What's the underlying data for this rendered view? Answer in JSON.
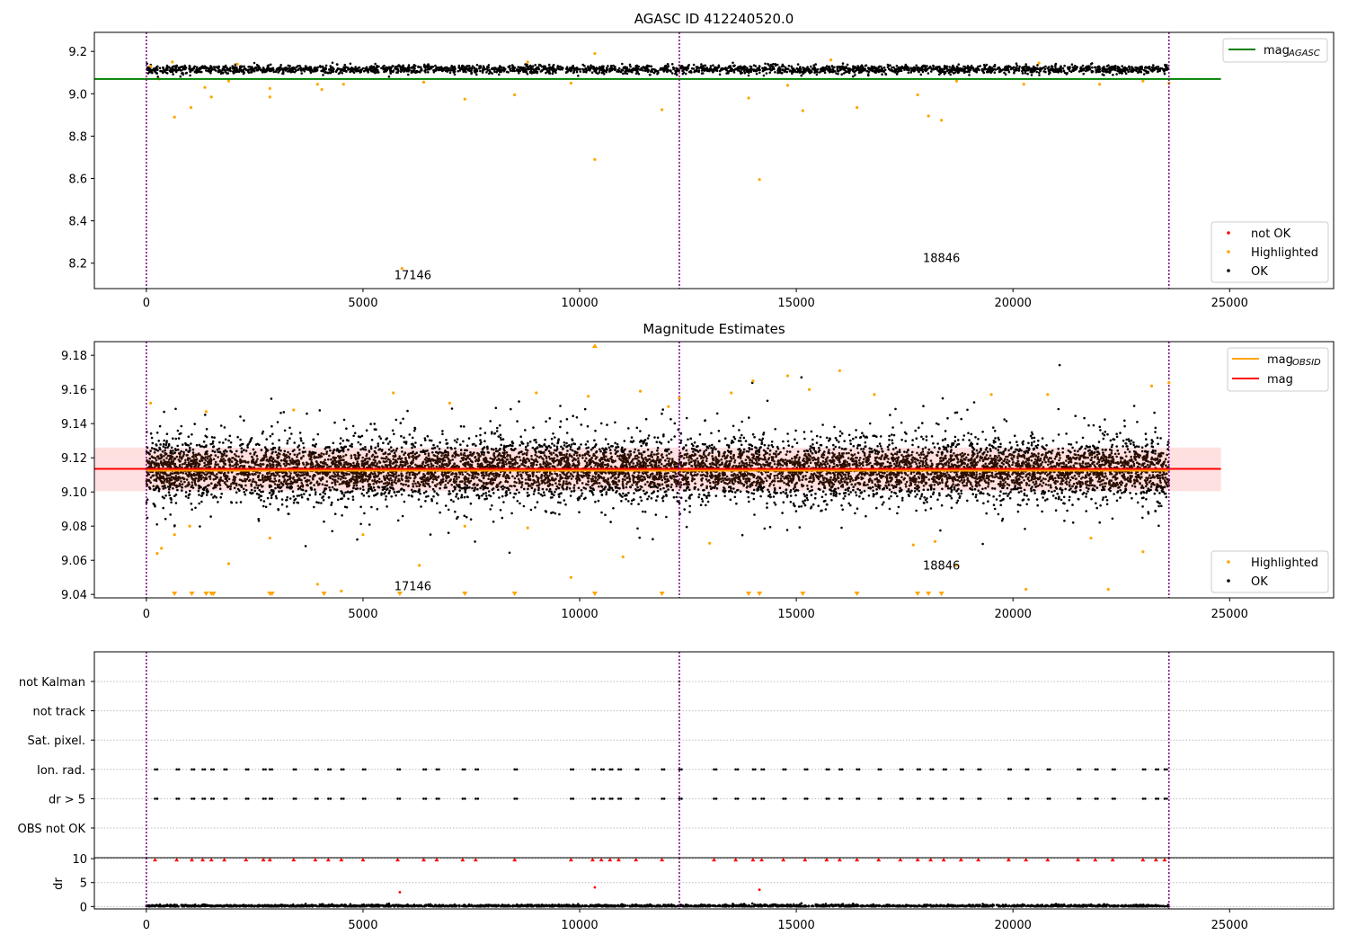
{
  "chart_data": [
    {
      "type": "scatter",
      "title": "AGASC ID 412240520.0",
      "xlim": [
        -1200,
        27400
      ],
      "ylim": [
        8.08,
        9.29
      ],
      "xticks": [
        "0",
        "5000",
        "10000",
        "15000",
        "20000",
        "25000"
      ],
      "xtick_values": [
        0,
        5000,
        10000,
        15000,
        20000,
        25000
      ],
      "yticks": [
        "8.2",
        "8.4",
        "8.6",
        "8.8",
        "9.0",
        "9.2"
      ],
      "ytick_values": [
        8.2,
        8.4,
        8.6,
        8.8,
        9.0,
        9.2
      ],
      "legend_upper": {
        "placement": "top-right",
        "entries": [
          {
            "label": "mag",
            "sub": "AGASC",
            "color": "#008000",
            "kind": "line"
          }
        ]
      },
      "legend_lower": {
        "placement": "bottom-right",
        "entries": [
          {
            "label": "not OK",
            "color": "#ff0000",
            "kind": "dot"
          },
          {
            "label": "Highlighted",
            "color": "#ffa500",
            "kind": "dot"
          },
          {
            "label": "OK",
            "color": "#000000",
            "kind": "dot"
          }
        ]
      },
      "mag_agasc": 9.07,
      "mag_agasc_xrange": [
        -1200,
        24800
      ],
      "obs_boundaries": [
        0,
        12300,
        23600
      ],
      "annotations": [
        {
          "text": "17146",
          "x": 6150,
          "y": 8.125
        },
        {
          "text": "18846",
          "x": 18350,
          "y": 8.205
        }
      ],
      "band": {
        "center": 9.115,
        "spread": 0.02
      },
      "highlighted_points": [
        [
          100,
          9.13
        ],
        [
          300,
          9.07
        ],
        [
          650,
          8.89
        ],
        [
          1030,
          8.935
        ],
        [
          1350,
          9.03
        ],
        [
          1500,
          8.985
        ],
        [
          1900,
          9.06
        ],
        [
          2850,
          9.025
        ],
        [
          2850,
          8.985
        ],
        [
          4050,
          9.02
        ],
        [
          4550,
          9.045
        ],
        [
          3950,
          9.045
        ],
        [
          5900,
          8.175
        ],
        [
          6400,
          9.055
        ],
        [
          7350,
          8.975
        ],
        [
          8500,
          8.995
        ],
        [
          9800,
          9.05
        ],
        [
          10350,
          9.19
        ],
        [
          10350,
          8.69
        ],
        [
          11900,
          8.925
        ],
        [
          13900,
          8.98
        ],
        [
          14150,
          8.595
        ],
        [
          14800,
          9.04
        ],
        [
          15150,
          8.92
        ],
        [
          16400,
          8.935
        ],
        [
          17800,
          8.995
        ],
        [
          18050,
          8.895
        ],
        [
          18350,
          8.875
        ],
        [
          18700,
          9.06
        ],
        [
          20250,
          9.045
        ],
        [
          22000,
          9.045
        ],
        [
          23000,
          9.06
        ],
        [
          23600,
          9.05
        ],
        [
          600,
          9.15
        ],
        [
          2100,
          9.14
        ],
        [
          8800,
          9.15
        ],
        [
          15800,
          9.16
        ],
        [
          20600,
          9.145
        ]
      ]
    },
    {
      "type": "scatter",
      "title": "Magnitude Estimates",
      "xlim": [
        -1200,
        27400
      ],
      "ylim": [
        9.038,
        9.188
      ],
      "xticks": [
        "0",
        "5000",
        "10000",
        "15000",
        "20000",
        "25000"
      ],
      "xtick_values": [
        0,
        5000,
        10000,
        15000,
        20000,
        25000
      ],
      "yticks": [
        "9.04",
        "9.06",
        "9.08",
        "9.10",
        "9.12",
        "9.14",
        "9.16",
        "9.18"
      ],
      "ytick_values": [
        9.04,
        9.06,
        9.08,
        9.1,
        9.12,
        9.14,
        9.16,
        9.18
      ],
      "legend_upper": {
        "placement": "top-right",
        "entries": [
          {
            "label": "mag",
            "sub": "OBSID",
            "color": "#ffa500",
            "kind": "line"
          },
          {
            "label": "mag",
            "sub": "",
            "color": "#ff0000",
            "kind": "line"
          }
        ]
      },
      "legend_lower": {
        "placement": "bottom-right",
        "entries": [
          {
            "label": "Highlighted",
            "color": "#ffa500",
            "kind": "dot"
          },
          {
            "label": "OK",
            "color": "#000000",
            "kind": "dot"
          }
        ]
      },
      "mag": 9.1135,
      "mag_obsid": 9.1125,
      "mag_band": [
        9.1005,
        9.126
      ],
      "mag_xrange": [
        -1200,
        24800
      ],
      "obs_boundaries": [
        0,
        12300,
        23600
      ],
      "annotations": [
        {
          "text": "17146",
          "x": 6150,
          "y": 9.0425
        },
        {
          "text": "18846",
          "x": 18350,
          "y": 9.0545
        }
      ],
      "band": {
        "center": 9.113,
        "spread": 0.011
      },
      "clipped_low_x": [
        650,
        1050,
        1380,
        1500,
        1550,
        2850,
        2900,
        4100,
        5850,
        7350,
        8500,
        10350,
        11900,
        13900,
        14150,
        15150,
        16400,
        17800,
        18050,
        18350
      ],
      "clipped_high_x": [
        10350
      ],
      "highlighted_points": [
        [
          100,
          9.152
        ],
        [
          250,
          9.064
        ],
        [
          350,
          9.067
        ],
        [
          650,
          9.075
        ],
        [
          1000,
          9.08
        ],
        [
          1380,
          9.147
        ],
        [
          1900,
          9.058
        ],
        [
          2850,
          9.073
        ],
        [
          3400,
          9.148
        ],
        [
          3950,
          9.046
        ],
        [
          4500,
          9.042
        ],
        [
          5000,
          9.075
        ],
        [
          5700,
          9.158
        ],
        [
          6300,
          9.057
        ],
        [
          7000,
          9.152
        ],
        [
          7350,
          9.08
        ],
        [
          8800,
          9.079
        ],
        [
          9000,
          9.158
        ],
        [
          9800,
          9.05
        ],
        [
          10200,
          9.156
        ],
        [
          11000,
          9.062
        ],
        [
          11400,
          9.159
        ],
        [
          12050,
          9.15
        ],
        [
          12300,
          9.155
        ],
        [
          13000,
          9.07
        ],
        [
          13500,
          9.158
        ],
        [
          14000,
          9.165
        ],
        [
          14800,
          9.168
        ],
        [
          15300,
          9.16
        ],
        [
          16000,
          9.171
        ],
        [
          16800,
          9.157
        ],
        [
          17700,
          9.069
        ],
        [
          18200,
          9.071
        ],
        [
          18700,
          9.057
        ],
        [
          19500,
          9.157
        ],
        [
          20300,
          9.043
        ],
        [
          20800,
          9.157
        ],
        [
          21800,
          9.073
        ],
        [
          22200,
          9.043
        ],
        [
          23000,
          9.065
        ],
        [
          23200,
          9.162
        ],
        [
          23600,
          9.164
        ]
      ]
    },
    {
      "type": "scatter",
      "title": "",
      "xlim": [
        -1200,
        27400
      ],
      "categories": [
        "not Kalman",
        "not track",
        "Sat. pixel.",
        "Ion. rad.",
        "dr > 5",
        "OBS not OK"
      ],
      "obs_boundaries": [
        0,
        12300,
        23600
      ],
      "flag_x": [
        200,
        700,
        1050,
        1300,
        1500,
        1800,
        2300,
        2700,
        2850,
        3400,
        3900,
        4200,
        4500,
        5000,
        5800,
        6400,
        6700,
        7300,
        7600,
        8500,
        9800,
        10300,
        10500,
        10700,
        10900,
        11300,
        11900,
        12300,
        13100,
        13600,
        14000,
        14200,
        14700,
        15200,
        15700,
        16000,
        16400,
        16900,
        17400,
        17800,
        18100,
        18400,
        18800,
        19200,
        19900,
        20300,
        20800,
        21500,
        21900,
        22300,
        23000,
        23300,
        23500
      ],
      "not_kalman_x": [
        12300
      ]
    },
    {
      "type": "scatter",
      "title": "",
      "xlim": [
        -1200,
        27400
      ],
      "ylim": [
        -0.5,
        10.2
      ],
      "ylabel": "dr",
      "xticks": [
        "0",
        "5000",
        "10000",
        "15000",
        "20000",
        "25000"
      ],
      "xtick_values": [
        0,
        5000,
        10000,
        15000,
        20000,
        25000
      ],
      "yticks": [
        "0",
        "5",
        "10"
      ],
      "ytick_values": [
        0,
        5,
        10
      ],
      "obs_boundaries": [
        0,
        12300,
        23600
      ],
      "clipped_top_x": [
        200,
        700,
        1050,
        1300,
        1500,
        1800,
        2300,
        2700,
        2850,
        3400,
        3900,
        4200,
        4500,
        5000,
        5800,
        6400,
        6700,
        7300,
        7600,
        8500,
        9800,
        10300,
        10500,
        10700,
        10900,
        11300,
        11900,
        13100,
        13600,
        14000,
        14200,
        14700,
        15200,
        15700,
        16000,
        16400,
        16900,
        17400,
        17800,
        18100,
        18400,
        18800,
        19200,
        19900,
        20300,
        20800,
        21500,
        21900,
        22300,
        23000,
        23300,
        23500
      ],
      "red_points": [
        [
          5850,
          3.0
        ],
        [
          10350,
          4.0
        ],
        [
          14150,
          3.5
        ]
      ]
    }
  ]
}
